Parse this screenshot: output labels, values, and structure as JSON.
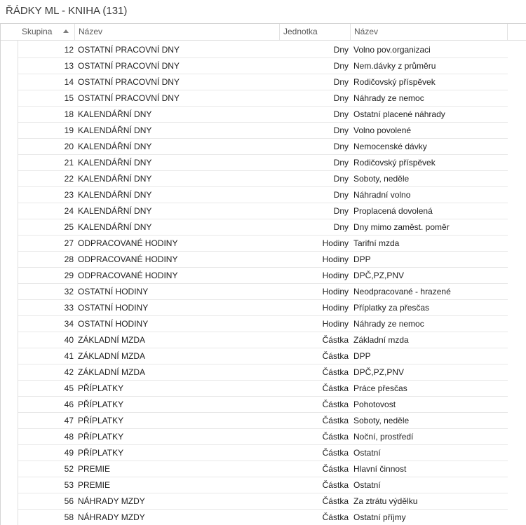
{
  "window": {
    "title": "ŘÁDKY ML - KNIHA (131)"
  },
  "grid": {
    "columns": {
      "skupina": "Skupina",
      "nazev": "Název",
      "jednotka": "Jednotka",
      "nazev_detail": "Název"
    },
    "sort": {
      "column": "skupina",
      "direction": "ascending",
      "icon": "sort-ascending-icon"
    },
    "rows": [
      {
        "skupina": "12",
        "nazev": "OSTATNÍ PRACOVNÍ DNY",
        "jednotka": "Dny",
        "detail": "Volno pov.organizaci"
      },
      {
        "skupina": "13",
        "nazev": "OSTATNÍ PRACOVNÍ DNY",
        "jednotka": "Dny",
        "detail": "Nem.dávky z průměru"
      },
      {
        "skupina": "14",
        "nazev": "OSTATNÍ PRACOVNÍ DNY",
        "jednotka": "Dny",
        "detail": "Rodičovský příspěvek"
      },
      {
        "skupina": "15",
        "nazev": "OSTATNÍ PRACOVNÍ DNY",
        "jednotka": "Dny",
        "detail": "Náhrady ze nemoc"
      },
      {
        "skupina": "18",
        "nazev": "KALENDÁŘNÍ DNY",
        "jednotka": "Dny",
        "detail": "Ostatní placené náhrady"
      },
      {
        "skupina": "19",
        "nazev": "KALENDÁŘNÍ DNY",
        "jednotka": "Dny",
        "detail": "Volno povolené"
      },
      {
        "skupina": "20",
        "nazev": "KALENDÁŘNÍ DNY",
        "jednotka": "Dny",
        "detail": "Nemocenské dávky"
      },
      {
        "skupina": "21",
        "nazev": "KALENDÁŘNÍ DNY",
        "jednotka": "Dny",
        "detail": "Rodičovský příspěvek"
      },
      {
        "skupina": "22",
        "nazev": "KALENDÁŘNÍ DNY",
        "jednotka": "Dny",
        "detail": "Soboty, neděle"
      },
      {
        "skupina": "23",
        "nazev": "KALENDÁŘNÍ DNY",
        "jednotka": "Dny",
        "detail": "Náhradní volno"
      },
      {
        "skupina": "24",
        "nazev": "KALENDÁŘNÍ DNY",
        "jednotka": "Dny",
        "detail": "Proplacená dovolená"
      },
      {
        "skupina": "25",
        "nazev": "KALENDÁŘNÍ DNY",
        "jednotka": "Dny",
        "detail": "Dny mimo zaměst. poměr"
      },
      {
        "skupina": "27",
        "nazev": "ODPRACOVANÉ HODINY",
        "jednotka": "Hodiny",
        "detail": "Tarifní mzda"
      },
      {
        "skupina": "28",
        "nazev": "ODPRACOVANÉ HODINY",
        "jednotka": "Hodiny",
        "detail": "DPP"
      },
      {
        "skupina": "29",
        "nazev": "ODPRACOVANÉ HODINY",
        "jednotka": "Hodiny",
        "detail": "DPČ,PZ,PNV"
      },
      {
        "skupina": "32",
        "nazev": "OSTATNÍ HODINY",
        "jednotka": "Hodiny",
        "detail": "Neodpracované - hrazené"
      },
      {
        "skupina": "33",
        "nazev": "OSTATNÍ HODINY",
        "jednotka": "Hodiny",
        "detail": "Příplatky za přesčas"
      },
      {
        "skupina": "34",
        "nazev": "OSTATNÍ HODINY",
        "jednotka": "Hodiny",
        "detail": "Náhrady ze nemoc"
      },
      {
        "skupina": "40",
        "nazev": "ZÁKLADNÍ MZDA",
        "jednotka": "Částka",
        "detail": "Základní mzda"
      },
      {
        "skupina": "41",
        "nazev": "ZÁKLADNÍ MZDA",
        "jednotka": "Částka",
        "detail": "DPP"
      },
      {
        "skupina": "42",
        "nazev": "ZÁKLADNÍ MZDA",
        "jednotka": "Částka",
        "detail": "DPČ,PZ,PNV"
      },
      {
        "skupina": "45",
        "nazev": "PŘÍPLATKY",
        "jednotka": "Částka",
        "detail": "Práce přesčas"
      },
      {
        "skupina": "46",
        "nazev": "PŘÍPLATKY",
        "jednotka": "Částka",
        "detail": "Pohotovost"
      },
      {
        "skupina": "47",
        "nazev": "PŘÍPLATKY",
        "jednotka": "Částka",
        "detail": "Soboty, neděle"
      },
      {
        "skupina": "48",
        "nazev": "PŘÍPLATKY",
        "jednotka": "Částka",
        "detail": "Noční, prostředí"
      },
      {
        "skupina": "49",
        "nazev": "PŘÍPLATKY",
        "jednotka": "Částka",
        "detail": "Ostatní"
      },
      {
        "skupina": "52",
        "nazev": "PREMIE",
        "jednotka": "Částka",
        "detail": "Hlavní činnost"
      },
      {
        "skupina": "53",
        "nazev": "PREMIE",
        "jednotka": "Částka",
        "detail": "Ostatní"
      },
      {
        "skupina": "56",
        "nazev": "NÁHRADY MZDY",
        "jednotka": "Částka",
        "detail": "Za ztrátu výdělku"
      },
      {
        "skupina": "58",
        "nazev": "NÁHRADY MZDY",
        "jednotka": "Částka",
        "detail": "Ostatní příjmy"
      }
    ]
  },
  "colors": {
    "header_text": "#5a5a5a",
    "row_text": "#1e1e1e",
    "grid_line": "#e8e8e8",
    "background": "#ffffff"
  }
}
